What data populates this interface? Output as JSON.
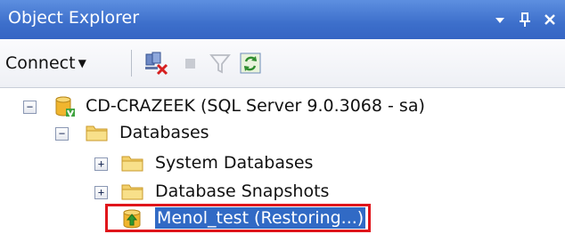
{
  "window": {
    "title": "Object Explorer",
    "controls": {
      "dropdown_glyph": "▾",
      "pin_glyph": "ᵠ",
      "close_glyph": "✕"
    }
  },
  "toolbar": {
    "connect_label": "Connect",
    "connect_caret": "▼",
    "tools": [
      {
        "icon": "disconnect-icon"
      },
      {
        "icon": "stop-icon"
      },
      {
        "icon": "filter-icon"
      },
      {
        "icon": "refresh-icon"
      }
    ]
  },
  "tree": {
    "server": {
      "expander": "−",
      "label": "CD-CRAZEEK (SQL Server 9.0.3068 - sa)"
    },
    "databases": {
      "expander": "−",
      "label": "Databases"
    },
    "system_databases": {
      "expander": "+",
      "label": "System Databases"
    },
    "database_snapshots": {
      "expander": "+",
      "label": "Database Snapshots"
    },
    "restoring_db": {
      "label": "Menol_test (Restoring...)"
    }
  },
  "colors": {
    "title_bar": "#3d6fcb",
    "selection": "#316ac5",
    "highlight_border": "#e0151b"
  }
}
